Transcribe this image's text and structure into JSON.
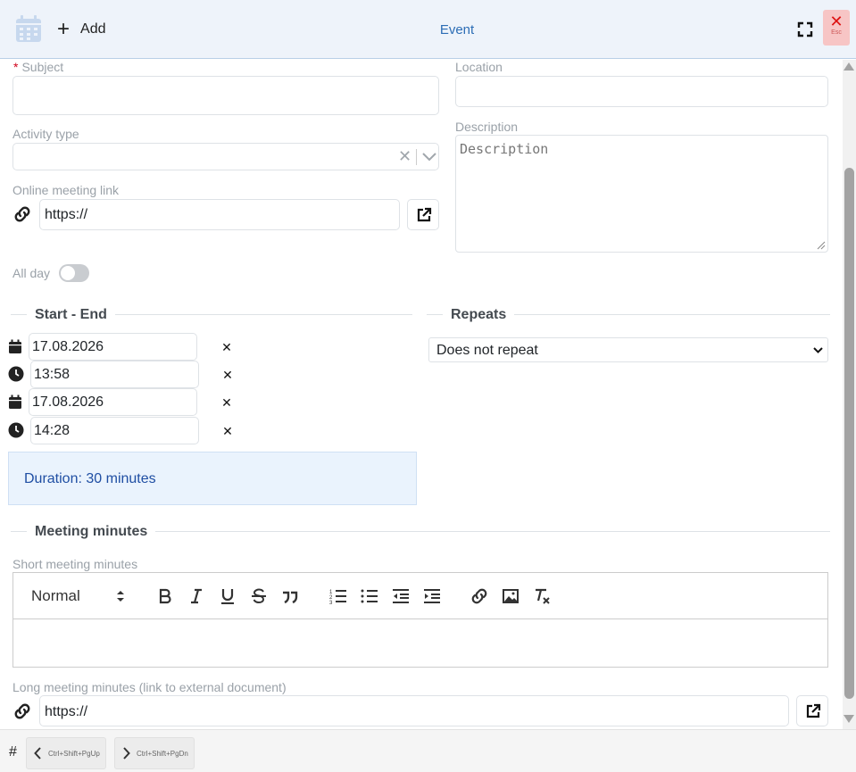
{
  "header": {
    "add_label": "Add",
    "title": "Event",
    "close_hint": "Esc"
  },
  "form": {
    "subject": {
      "label": "Subject",
      "required_mark": "*",
      "value": ""
    },
    "location": {
      "label": "Location",
      "value": ""
    },
    "activity_type": {
      "label": "Activity type",
      "value": ""
    },
    "description": {
      "label": "Description",
      "placeholder": "Description"
    },
    "online_link": {
      "label": "Online meeting link",
      "value": "https://"
    },
    "all_day": {
      "label": "All day",
      "on": false
    }
  },
  "start_end": {
    "title": "Start - End",
    "start_date": "17.08.2026",
    "start_time": "13:58",
    "end_date": "17.08.2026",
    "end_time": "14:28",
    "clear_glyph": "✕",
    "duration": "Duration: 30 minutes"
  },
  "repeats": {
    "title": "Repeats",
    "selected": "Does not repeat"
  },
  "minutes": {
    "title": "Meeting minutes",
    "short_label": "Short meeting minutes",
    "format_value": "Normal",
    "long_label": "Long meeting minutes (link to external document)",
    "long_value": "https://"
  },
  "footer": {
    "hash": "#",
    "prev_hint": "Ctrl+Shift+PgUp",
    "next_hint": "Ctrl+Shift+PgDn"
  },
  "colors": {
    "header_bg": "#eef3fa",
    "accent": "#2c6db5",
    "duration_bg": "#eaf3fd",
    "close_bg": "#f7c5c5"
  }
}
